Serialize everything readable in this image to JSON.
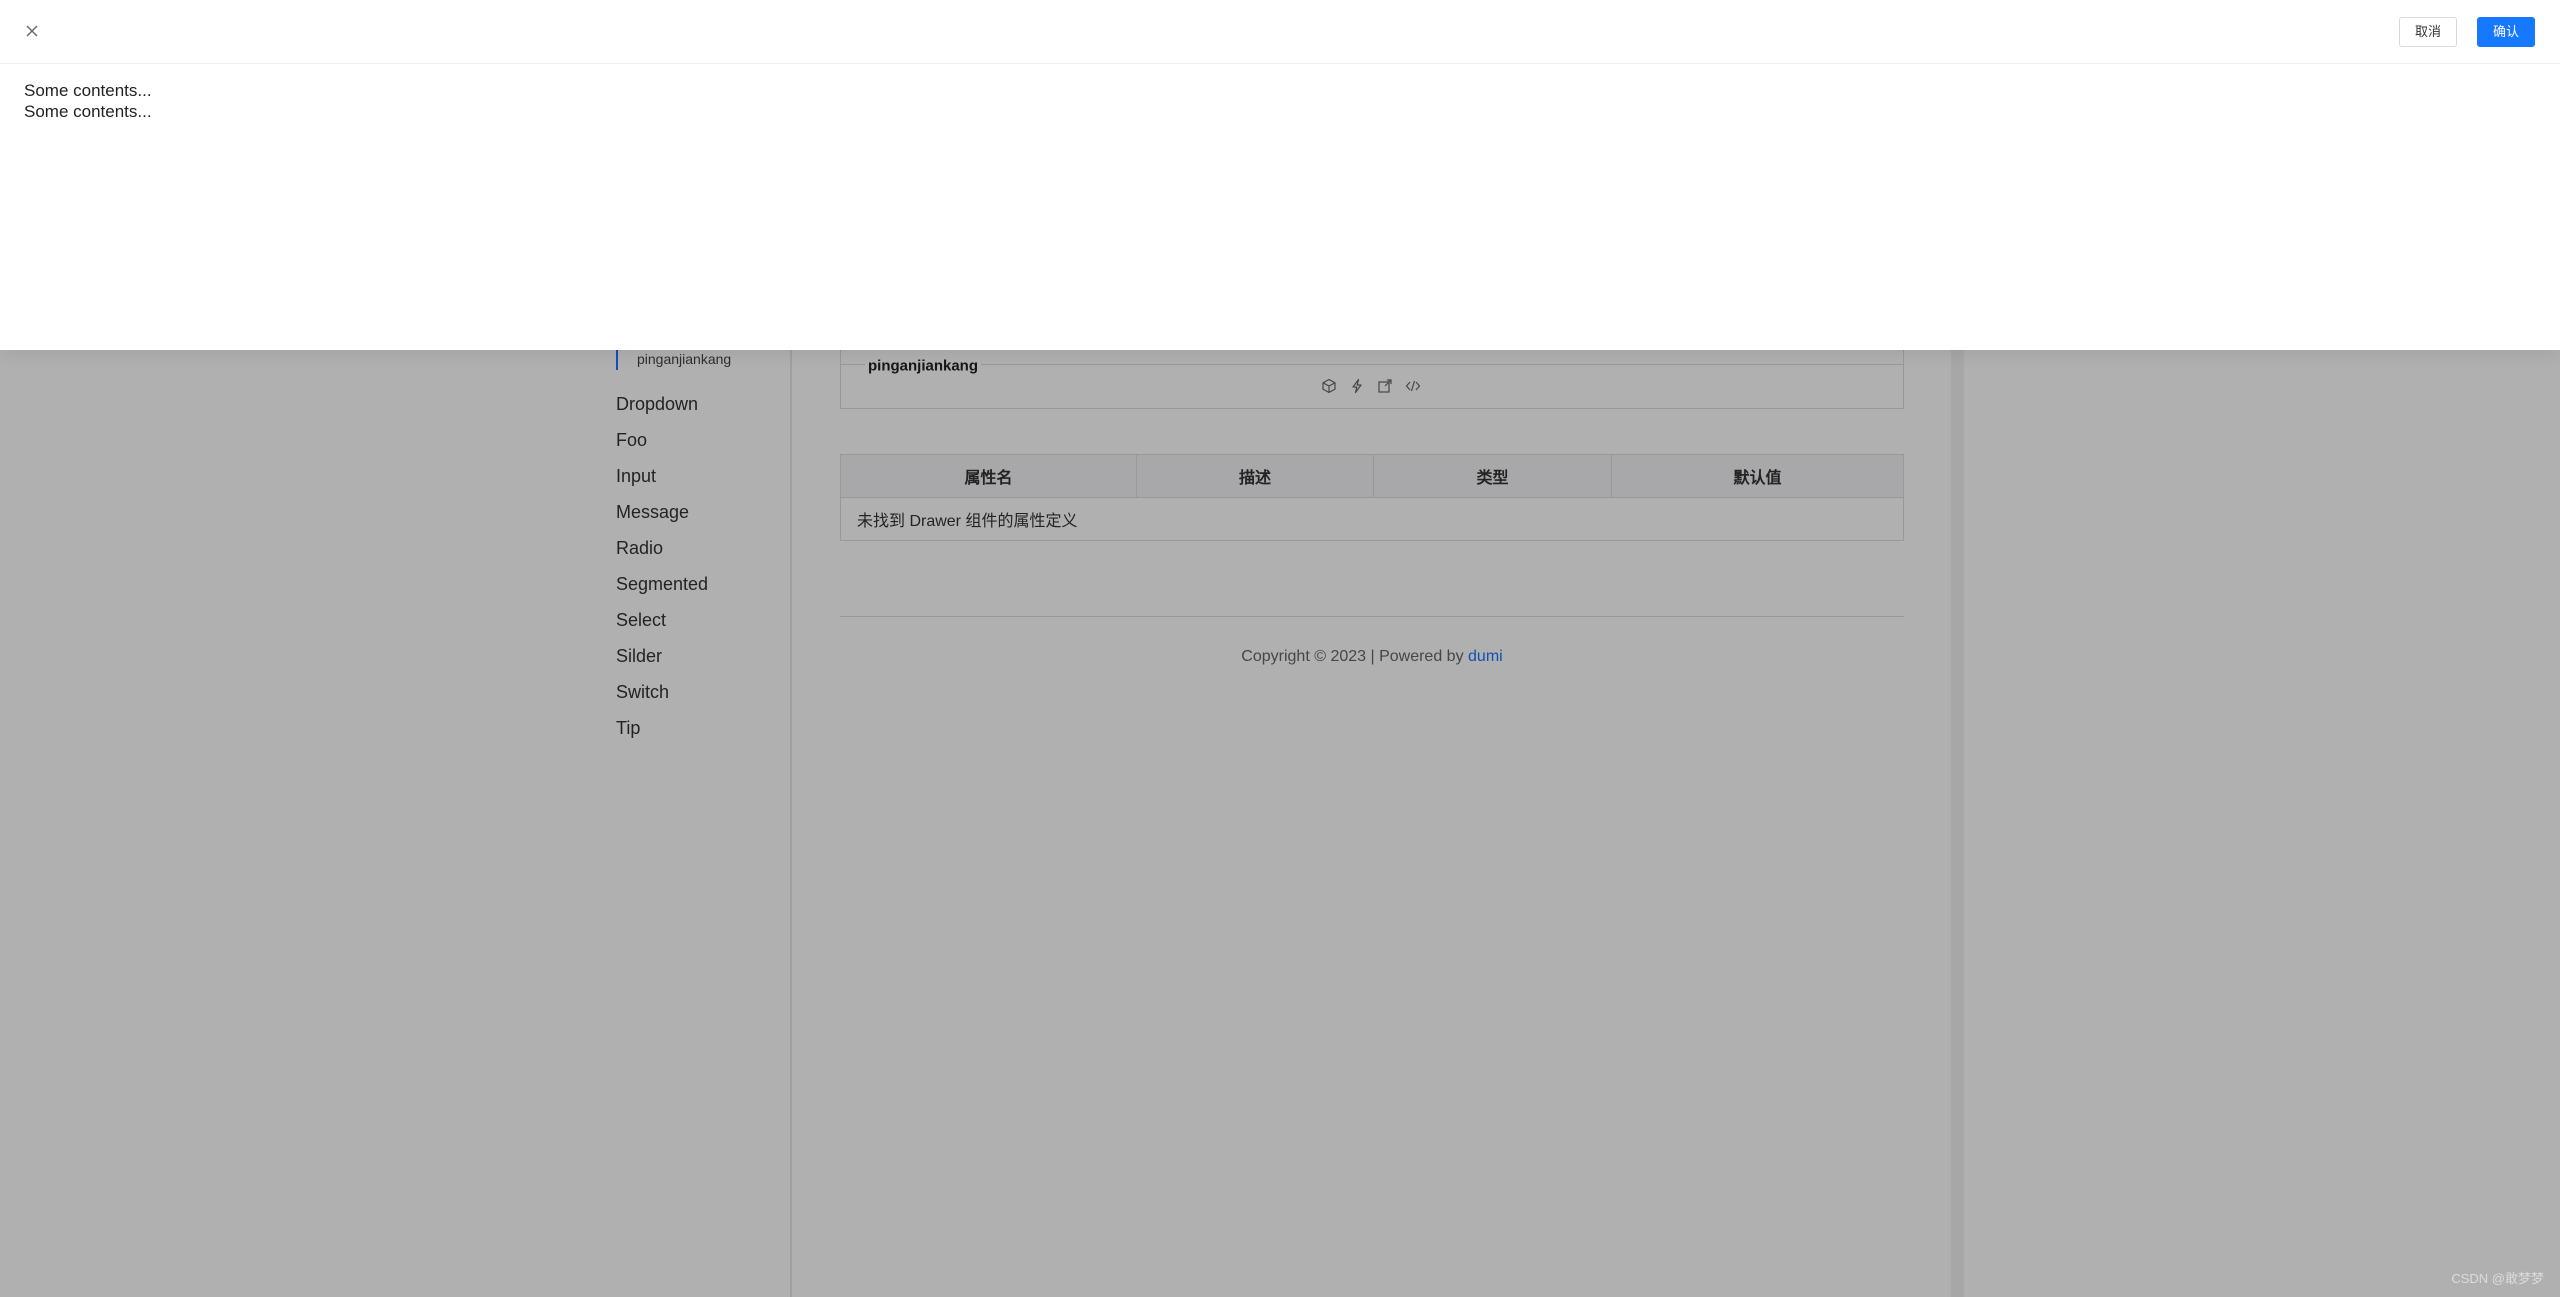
{
  "drawer": {
    "cancel_label": "取消",
    "ok_label": "确认",
    "content_lines": [
      "Some contents...",
      "Some contents..."
    ]
  },
  "sidebar": {
    "active_sub_item": "pinganjiankang",
    "items": [
      "Dropdown",
      "Foo",
      "Input",
      "Message",
      "Radio",
      "Segmented",
      "Select",
      "Silder",
      "Switch",
      "Tip"
    ]
  },
  "demo": {
    "title": "pinganjiankang",
    "actions": [
      "codesandbox-icon",
      "stackblitz-icon",
      "open-external-icon",
      "code-icon"
    ]
  },
  "api_table": {
    "headers": [
      "属性名",
      "描述",
      "类型",
      "默认值"
    ],
    "empty_message": "未找到 Drawer 组件的属性定义"
  },
  "footer": {
    "text": "Copyright © 2023 | Powered by ",
    "link_text": "dumi"
  },
  "watermark": "CSDN @敢梦梦",
  "colors": {
    "accent": "#1677ff",
    "mask": "rgba(0,0,0,0.31)"
  }
}
